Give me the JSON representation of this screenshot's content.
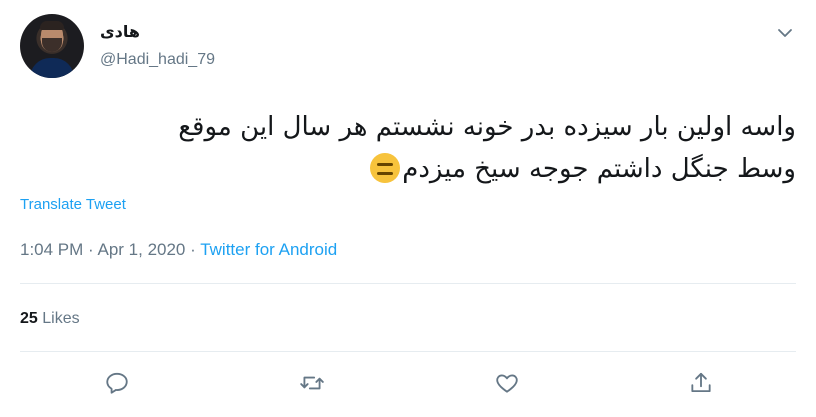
{
  "user": {
    "display_name": "هادی",
    "handle": "@Hadi_hadi_79",
    "avatar_icon": "profile-photo"
  },
  "tweet": {
    "line1": "واسه اولین بار سیزده بدر خونه نشستم هر سال این موقع",
    "line2": "وسط جنگل داشتم جوجه سیخ میزدم",
    "emoji": "expressionless-face"
  },
  "translate_label": "Translate Tweet",
  "meta": {
    "time": "1:04 PM",
    "sep1": " · ",
    "date": "Apr 1, 2020",
    "sep2": " · ",
    "source": "Twitter for Android"
  },
  "stats": {
    "likes_count": "25",
    "likes_label": "Likes"
  },
  "actions": {
    "reply": "reply-icon",
    "retweet": "retweet-icon",
    "like": "heart-icon",
    "share": "share-icon"
  },
  "colors": {
    "accent": "#1da1f2",
    "muted": "#657786",
    "text": "#14171a",
    "divider": "#e6ecf0"
  }
}
